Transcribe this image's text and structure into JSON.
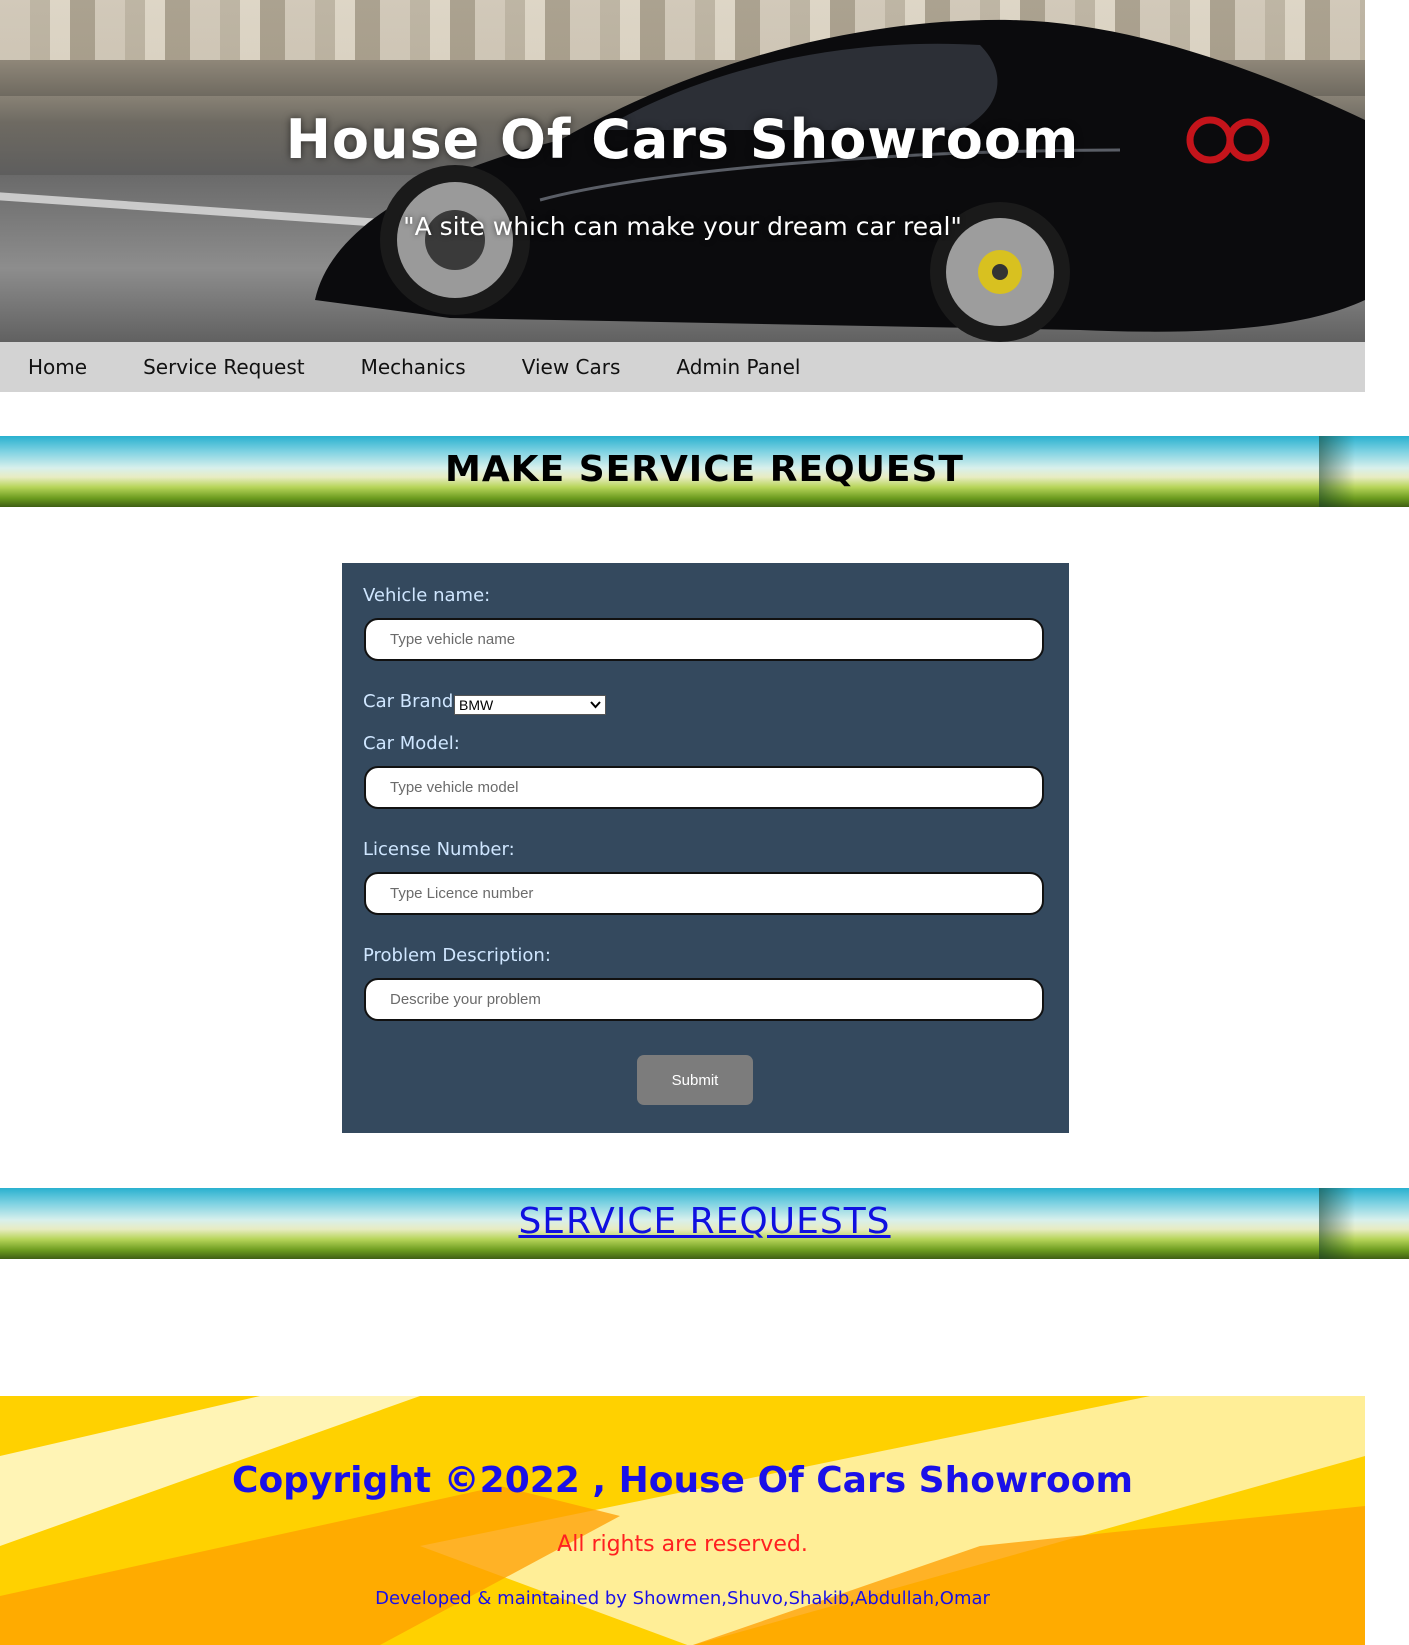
{
  "hero": {
    "title": "House Of Cars Showroom",
    "tagline": "\"A site which can make your dream car real\""
  },
  "nav": {
    "items": [
      "Home",
      "Service Request",
      "Mechanics",
      "View Cars",
      "Admin Panel"
    ]
  },
  "make_request": {
    "heading": "MAKE SERVICE REQUEST"
  },
  "form": {
    "vehicle_name_label": "Vehicle name:",
    "vehicle_name_placeholder": "Type vehicle name",
    "car_brand_label": "Car Brand:",
    "car_brand_selected": "BMW",
    "car_model_label": "Car Model:",
    "car_model_placeholder": "Type vehicle model",
    "license_label": "License Number:",
    "license_placeholder": "Type Licence number",
    "problem_label": "Problem Description:",
    "problem_placeholder": "Describe your problem",
    "submit_label": "Submit"
  },
  "service_requests": {
    "heading": "SERVICE REQUESTS"
  },
  "footer": {
    "copyright": "Copyright ©2022 , House Of Cars Showroom",
    "rights": "All rights are reserved.",
    "developed": "Developed & maintained by Showmen,Shuvo,Shakib,Abdullah,Omar"
  },
  "colors": {
    "form_bg": "#34495e",
    "nav_bg": "#d3d3d3",
    "footer_bg": "#ffd100",
    "footer_title": "#1a10e8",
    "footer_rights": "#ff2020",
    "link": "#1010e0"
  }
}
